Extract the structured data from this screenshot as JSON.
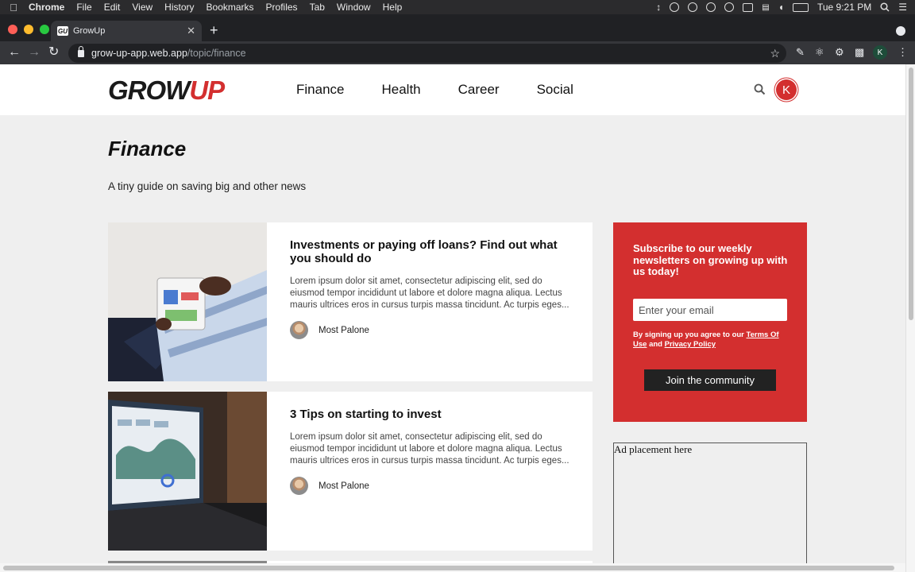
{
  "menubar": {
    "app": "Chrome",
    "items": [
      "File",
      "Edit",
      "View",
      "History",
      "Bookmarks",
      "Profiles",
      "Tab",
      "Window",
      "Help"
    ],
    "clock": "Tue 9:21 PM"
  },
  "browser": {
    "tab_title": "GrowUp",
    "tab_favicon": "GU",
    "url_host": "grow-up-app.web.app",
    "url_path": "/topic/finance",
    "profile_initial": "K"
  },
  "site": {
    "logo_main": "GROW",
    "logo_accent": "UP",
    "nav": [
      "Finance",
      "Health",
      "Career",
      "Social"
    ],
    "user_initial": "K",
    "brand_color": "#d32f2f"
  },
  "topic": {
    "title": "Finance",
    "subtitle": "A tiny guide on saving big and other news"
  },
  "articles": [
    {
      "title": "Investments or paying off loans? Find out what you should do",
      "excerpt": "Lorem ipsum dolor sit amet, consectetur adipiscing elit, sed do eiusmod tempor incididunt ut labore et dolore magna aliqua. Lectus mauris ultrices eros in cursus turpis massa tincidunt. Ac turpis eges...",
      "author": "Most Palone"
    },
    {
      "title": "3 Tips on starting to invest",
      "excerpt": "Lorem ipsum dolor sit amet, consectetur adipiscing elit, sed do eiusmod tempor incididunt ut labore et dolore magna aliqua. Lectus mauris ultrices eros in cursus turpis massa tincidunt. Ac turpis eges...",
      "author": "Most Palone"
    }
  ],
  "subscribe": {
    "heading": "Subscribe to our weekly newsletters on growing up with us today!",
    "email_placeholder": "Enter your email",
    "terms_prefix": "By signing up you agree to our ",
    "terms_link": "Terms Of Use",
    "terms_and": " and ",
    "privacy_link": "Privacy Policy",
    "button": "Join the community"
  },
  "ad": {
    "text": "Ad placement here"
  }
}
